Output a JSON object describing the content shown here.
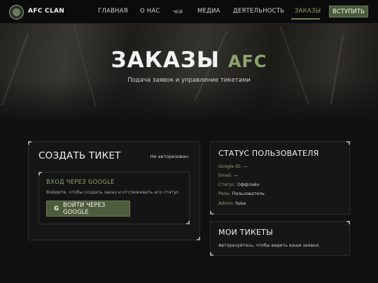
{
  "nav": {
    "brand": "AFC CLAN",
    "links": [
      "ГЛАВНАЯ",
      "О НАС",
      "ЧЕЙ",
      "МЕДИА",
      "ДЕЯТЕЛЬНОСТЬ",
      "ЗАКАЗЫ"
    ],
    "active_link": "ЗАКАЗЫ",
    "join_label": "ВСТУПИТЬ"
  },
  "hero": {
    "title": "ЗАКАЗЫ",
    "title_accent": "AFC",
    "subtitle": "Подача заявок и управление тикетами"
  },
  "create_ticket": {
    "title": "СОЗДАТЬ ТИКЕТ",
    "auth_status": "Не авторизован",
    "login_title": "ВХОД ЧЕРЕЗ GOOGLE",
    "login_desc": "Войдите, чтобы создать заказ и отслеживать его статус.",
    "google_icon": "G",
    "google_button": "ВОЙТИ ЧЕРЕЗ GOOGLE"
  },
  "user_status": {
    "title": "СТАТУС ПОЛЬЗОВАТЕЛЯ",
    "rows": [
      {
        "key": "Google ID:",
        "value": "—"
      },
      {
        "key": "Email:",
        "value": "—"
      },
      {
        "key": "Статус:",
        "value": "Оффлайн"
      },
      {
        "key": "Роль:",
        "value": "Пользователь"
      },
      {
        "key": "Admin:",
        "value": "false"
      }
    ]
  },
  "my_tickets": {
    "title": "МОИ ТИКЕТЫ",
    "desc": "Авторизуйтесь, чтобы видеть ваши заявки."
  },
  "colors": {
    "accent": "#8fa46a",
    "button": "#4d5c3a",
    "background": "#111111"
  }
}
